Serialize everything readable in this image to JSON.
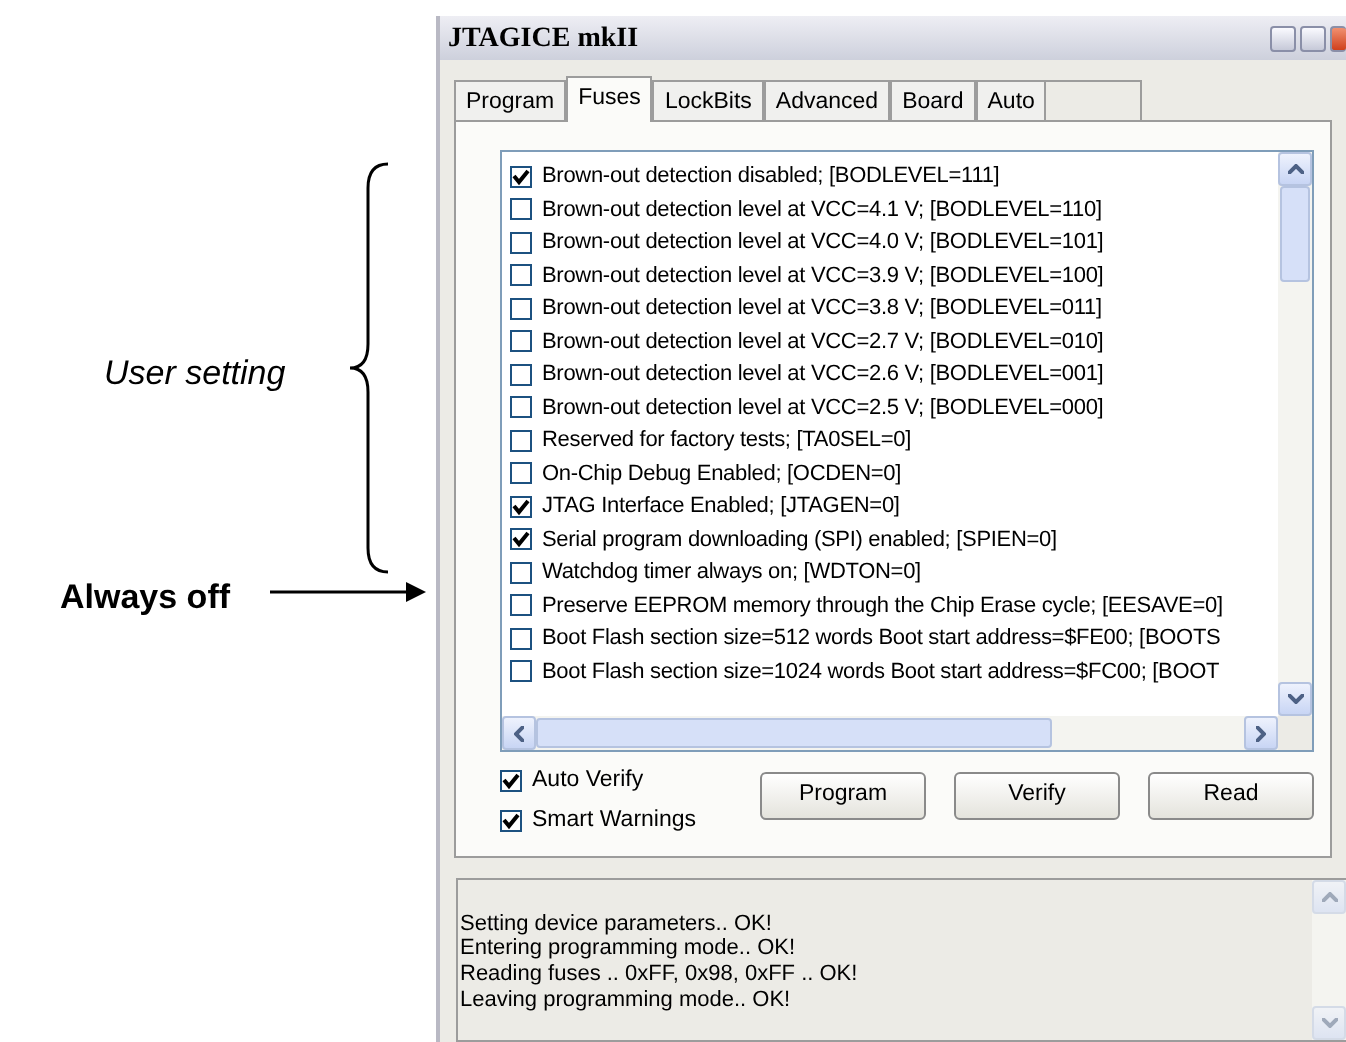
{
  "annotations": [
    {
      "kind": "brace",
      "text": "User setting"
    },
    {
      "kind": "arrow",
      "text": "Always off"
    }
  ],
  "window": {
    "title": "JTAGICE mkII"
  },
  "tabs": [
    {
      "label": "Program",
      "selected": false
    },
    {
      "label": "Fuses",
      "selected": true
    },
    {
      "label": "LockBits",
      "selected": false
    },
    {
      "label": "Advanced",
      "selected": false
    },
    {
      "label": "Board",
      "selected": false
    },
    {
      "label": "Auto",
      "selected": false
    }
  ],
  "fuses": [
    {
      "label": "Brown-out detection disabled; [BODLEVEL=111]",
      "checked": true
    },
    {
      "label": "Brown-out detection level at VCC=4.1 V; [BODLEVEL=110]",
      "checked": false
    },
    {
      "label": "Brown-out detection level at VCC=4.0 V; [BODLEVEL=101]",
      "checked": false
    },
    {
      "label": "Brown-out detection level at VCC=3.9 V; [BODLEVEL=100]",
      "checked": false
    },
    {
      "label": "Brown-out detection level at VCC=3.8 V; [BODLEVEL=011]",
      "checked": false
    },
    {
      "label": "Brown-out detection level at VCC=2.7 V; [BODLEVEL=010]",
      "checked": false
    },
    {
      "label": "Brown-out detection level at VCC=2.6 V; [BODLEVEL=001]",
      "checked": false
    },
    {
      "label": "Brown-out detection level at VCC=2.5 V; [BODLEVEL=000]",
      "checked": false
    },
    {
      "label": "Reserved for factory tests; [TA0SEL=0]",
      "checked": false
    },
    {
      "label": "On-Chip Debug Enabled; [OCDEN=0]",
      "checked": false
    },
    {
      "label": "JTAG Interface Enabled; [JTAGEN=0]",
      "checked": true
    },
    {
      "label": "Serial program downloading (SPI) enabled; [SPIEN=0]",
      "checked": true
    },
    {
      "label": "Watchdog timer always on; [WDTON=0]",
      "checked": false
    },
    {
      "label": "Preserve EEPROM memory through the Chip Erase cycle; [EESAVE=0]",
      "checked": false
    },
    {
      "label": "Boot Flash section size=512 words Boot start address=$FE00; [BOOTS",
      "checked": false
    },
    {
      "label": "Boot Flash section size=1024 words Boot start address=$FC00; [BOOT",
      "checked": false
    }
  ],
  "options": [
    {
      "label": "Auto Verify",
      "checked": true
    },
    {
      "label": "Smart Warnings",
      "checked": true
    }
  ],
  "buttons": [
    "Program",
    "Verify",
    "Read"
  ],
  "log": [
    "Setting device parameters.. OK!",
    "Entering programming mode.. OK!",
    "Reading fuses .. 0xFF, 0x98, 0xFF .. OK!",
    "Leaving programming mode.. OK!"
  ]
}
